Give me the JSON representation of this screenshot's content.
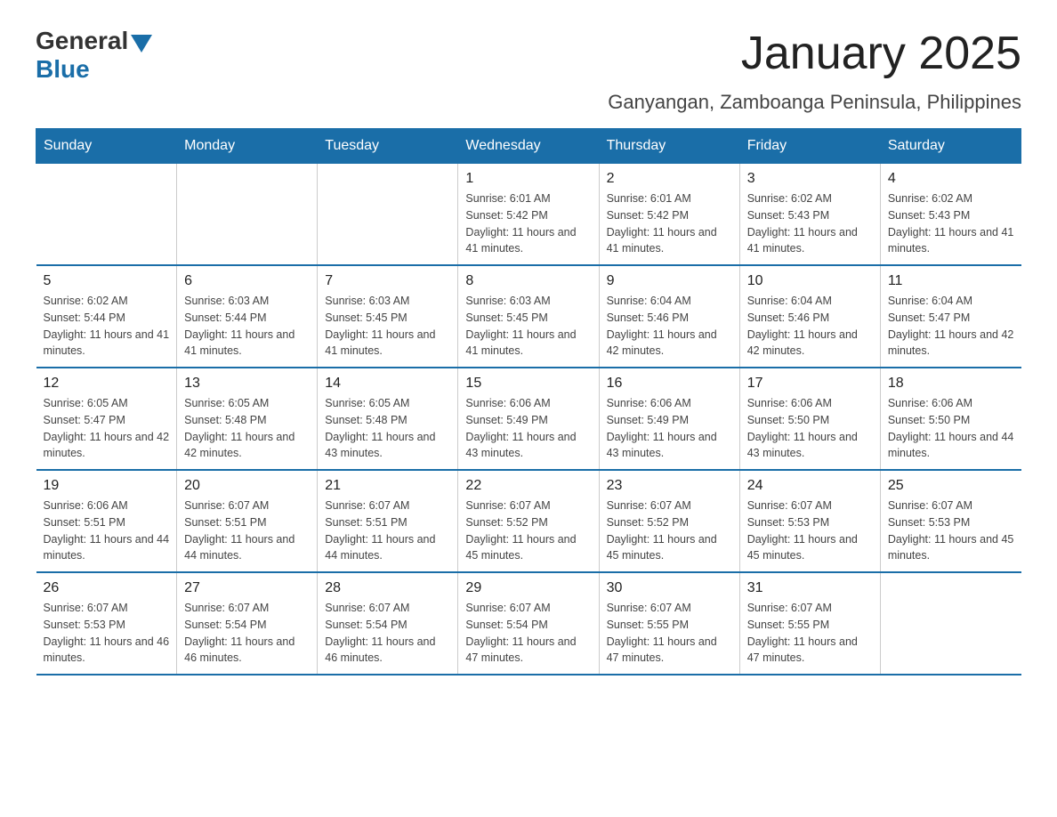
{
  "logo": {
    "general": "General",
    "blue": "Blue"
  },
  "title": "January 2025",
  "location": "Ganyangan, Zamboanga Peninsula, Philippines",
  "days_of_week": [
    "Sunday",
    "Monday",
    "Tuesday",
    "Wednesday",
    "Thursday",
    "Friday",
    "Saturday"
  ],
  "weeks": [
    [
      {
        "day": "",
        "info": ""
      },
      {
        "day": "",
        "info": ""
      },
      {
        "day": "",
        "info": ""
      },
      {
        "day": "1",
        "info": "Sunrise: 6:01 AM\nSunset: 5:42 PM\nDaylight: 11 hours and 41 minutes."
      },
      {
        "day": "2",
        "info": "Sunrise: 6:01 AM\nSunset: 5:42 PM\nDaylight: 11 hours and 41 minutes."
      },
      {
        "day": "3",
        "info": "Sunrise: 6:02 AM\nSunset: 5:43 PM\nDaylight: 11 hours and 41 minutes."
      },
      {
        "day": "4",
        "info": "Sunrise: 6:02 AM\nSunset: 5:43 PM\nDaylight: 11 hours and 41 minutes."
      }
    ],
    [
      {
        "day": "5",
        "info": "Sunrise: 6:02 AM\nSunset: 5:44 PM\nDaylight: 11 hours and 41 minutes."
      },
      {
        "day": "6",
        "info": "Sunrise: 6:03 AM\nSunset: 5:44 PM\nDaylight: 11 hours and 41 minutes."
      },
      {
        "day": "7",
        "info": "Sunrise: 6:03 AM\nSunset: 5:45 PM\nDaylight: 11 hours and 41 minutes."
      },
      {
        "day": "8",
        "info": "Sunrise: 6:03 AM\nSunset: 5:45 PM\nDaylight: 11 hours and 41 minutes."
      },
      {
        "day": "9",
        "info": "Sunrise: 6:04 AM\nSunset: 5:46 PM\nDaylight: 11 hours and 42 minutes."
      },
      {
        "day": "10",
        "info": "Sunrise: 6:04 AM\nSunset: 5:46 PM\nDaylight: 11 hours and 42 minutes."
      },
      {
        "day": "11",
        "info": "Sunrise: 6:04 AM\nSunset: 5:47 PM\nDaylight: 11 hours and 42 minutes."
      }
    ],
    [
      {
        "day": "12",
        "info": "Sunrise: 6:05 AM\nSunset: 5:47 PM\nDaylight: 11 hours and 42 minutes."
      },
      {
        "day": "13",
        "info": "Sunrise: 6:05 AM\nSunset: 5:48 PM\nDaylight: 11 hours and 42 minutes."
      },
      {
        "day": "14",
        "info": "Sunrise: 6:05 AM\nSunset: 5:48 PM\nDaylight: 11 hours and 43 minutes."
      },
      {
        "day": "15",
        "info": "Sunrise: 6:06 AM\nSunset: 5:49 PM\nDaylight: 11 hours and 43 minutes."
      },
      {
        "day": "16",
        "info": "Sunrise: 6:06 AM\nSunset: 5:49 PM\nDaylight: 11 hours and 43 minutes."
      },
      {
        "day": "17",
        "info": "Sunrise: 6:06 AM\nSunset: 5:50 PM\nDaylight: 11 hours and 43 minutes."
      },
      {
        "day": "18",
        "info": "Sunrise: 6:06 AM\nSunset: 5:50 PM\nDaylight: 11 hours and 44 minutes."
      }
    ],
    [
      {
        "day": "19",
        "info": "Sunrise: 6:06 AM\nSunset: 5:51 PM\nDaylight: 11 hours and 44 minutes."
      },
      {
        "day": "20",
        "info": "Sunrise: 6:07 AM\nSunset: 5:51 PM\nDaylight: 11 hours and 44 minutes."
      },
      {
        "day": "21",
        "info": "Sunrise: 6:07 AM\nSunset: 5:51 PM\nDaylight: 11 hours and 44 minutes."
      },
      {
        "day": "22",
        "info": "Sunrise: 6:07 AM\nSunset: 5:52 PM\nDaylight: 11 hours and 45 minutes."
      },
      {
        "day": "23",
        "info": "Sunrise: 6:07 AM\nSunset: 5:52 PM\nDaylight: 11 hours and 45 minutes."
      },
      {
        "day": "24",
        "info": "Sunrise: 6:07 AM\nSunset: 5:53 PM\nDaylight: 11 hours and 45 minutes."
      },
      {
        "day": "25",
        "info": "Sunrise: 6:07 AM\nSunset: 5:53 PM\nDaylight: 11 hours and 45 minutes."
      }
    ],
    [
      {
        "day": "26",
        "info": "Sunrise: 6:07 AM\nSunset: 5:53 PM\nDaylight: 11 hours and 46 minutes."
      },
      {
        "day": "27",
        "info": "Sunrise: 6:07 AM\nSunset: 5:54 PM\nDaylight: 11 hours and 46 minutes."
      },
      {
        "day": "28",
        "info": "Sunrise: 6:07 AM\nSunset: 5:54 PM\nDaylight: 11 hours and 46 minutes."
      },
      {
        "day": "29",
        "info": "Sunrise: 6:07 AM\nSunset: 5:54 PM\nDaylight: 11 hours and 47 minutes."
      },
      {
        "day": "30",
        "info": "Sunrise: 6:07 AM\nSunset: 5:55 PM\nDaylight: 11 hours and 47 minutes."
      },
      {
        "day": "31",
        "info": "Sunrise: 6:07 AM\nSunset: 5:55 PM\nDaylight: 11 hours and 47 minutes."
      },
      {
        "day": "",
        "info": ""
      }
    ]
  ]
}
